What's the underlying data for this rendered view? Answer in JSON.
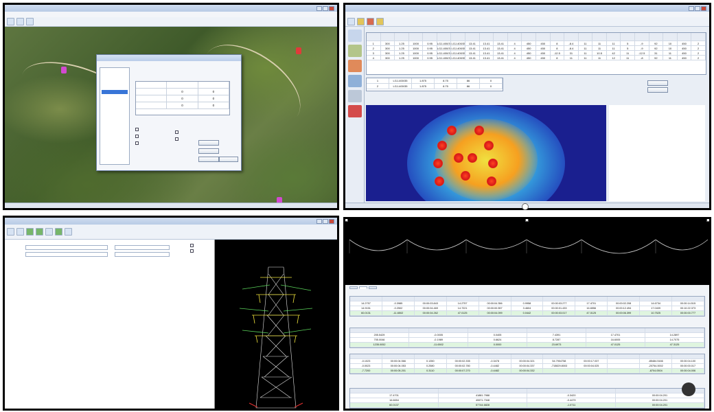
{
  "panel_tl": {
    "title": "",
    "coords": "",
    "status": "",
    "dialog": {
      "title": "",
      "tree_items": [
        "",
        "",
        "",
        "",
        "",
        "",
        ""
      ],
      "grid_cells": [
        "0",
        "0",
        "0",
        "0",
        "0",
        "0"
      ],
      "buttons": [
        "",
        "",
        "",
        ""
      ]
    }
  },
  "panel_tr": {
    "title": "",
    "table_rows": [
      [
        "1",
        "300",
        "1.25",
        "1000",
        "0.95",
        "LGJ-400/35",
        "LGJ-400/35",
        "13.41",
        "13.41",
        "13.41",
        "4",
        "450",
        "450",
        "8",
        "-8.4",
        "11",
        "11",
        "11",
        "5",
        "-9",
        "92",
        "10",
        "450",
        "2"
      ],
      [
        "2",
        "300",
        "1.25",
        "1000",
        "0.95",
        "LGJ-400/35",
        "LGJ-400/35",
        "13.41",
        "13.41",
        "13.41",
        "4",
        "450",
        "450",
        "8",
        "-8.4",
        "11",
        "11",
        "11",
        "5",
        "-9",
        "92",
        "10",
        "450",
        "2"
      ],
      [
        "3",
        "300",
        "1.25",
        "1000",
        "0.95",
        "LGJ-400/35",
        "LGJ-400/35",
        "13.41",
        "13.41",
        "13.41",
        "4",
        "450",
        "450",
        "-12.5",
        "31",
        "11",
        "10.5",
        "42",
        "11",
        "-12.5",
        "31",
        "11",
        "450",
        "2"
      ],
      [
        "4",
        "300",
        "1.25",
        "1000",
        "0.95",
        "LGJ-400/35",
        "LGJ-400/35",
        "13.41",
        "13.41",
        "13.41",
        "4",
        "450",
        "450",
        "8",
        "11",
        "11",
        "11",
        "12",
        "11",
        "-8",
        "92",
        "11",
        "450",
        "2"
      ]
    ],
    "sub_rows": [
      [
        "1",
        "LGJ-400/35",
        "1.875",
        "8.75",
        "86",
        "0"
      ],
      [
        "2",
        "LGJ-400/35",
        "1.875",
        "8.75",
        "86",
        "0"
      ]
    ],
    "buttons": [
      "",
      ""
    ],
    "legend_lines": []
  },
  "panel_bl": {
    "title": "",
    "text_lines": []
  },
  "panel_br": {
    "catenary_labels": [],
    "tables": [
      {
        "rows": [
          [
            "14.2757",
            "-0.3985",
            "00:00:03.843",
            "14.2757",
            "00:00:04.356",
            "0.9958",
            "00:00:03.277",
            "17.4701",
            "00:00:02.208",
            "14.6734",
            "00:00:14.515"
          ],
          [
            "14.9151",
            "-0.2502",
            "00:00:04.469",
            "14.7221",
            "00:00:00.557",
            "3.4604",
            "00:00:01.433",
            "16.6556",
            "00:00:12.494",
            "17.0409",
            "00:10:22.373"
          ],
          [
            "60.0131",
            "-11.6502",
            "00:00:04.262",
            "47.0125",
            "00:00:04.099",
            "0.0442",
            "00:00:03.017",
            "47.0125",
            "00:00:06.399",
            "10.7525",
            "00:00:00.777"
          ]
        ]
      },
      {
        "rows": [
          [
            "205.5429",
            "-0.0005",
            "0.0405",
            "7.4391",
            "17.4701",
            "14.2897"
          ],
          [
            "705.0046",
            "-0.1989",
            "0.6624",
            "8.7287",
            "16.6005",
            "14.7075"
          ],
          [
            "1235.0052",
            "-11.6502",
            "0.0000",
            "23.6973",
            "47.0125",
            "47.3125"
          ]
        ]
      },
      {
        "rows": [
          [
            "-0.1023",
            "00:00:04.566",
            "0.1350",
            "00:00:02.335",
            "-0.3478",
            "00:00:04.321",
            "54.7904758",
            "00:00:17.037",
            "",
            "-85484.5166",
            "00:00:04.100"
          ],
          [
            "-0.0023",
            "00:00:04.053",
            "0.2580",
            "00:00:02.780",
            "-0.4482",
            "00:00:04.337",
            "-715829.8003",
            "00:00:04.025",
            "",
            "-20754.0002",
            "00:00:00.017"
          ],
          [
            "-7.7200",
            "00:00:05.201",
            "0.3110",
            "00:00:07.270",
            "-0.4482",
            "00:00:04.332",
            "",
            "",
            "",
            "-8704.0504",
            "00:00:04.006"
          ]
        ]
      },
      {
        "rows": [
          [
            "17.4701",
            "41881.7988",
            "-0.3420",
            "00:00:04.201"
          ],
          [
            "16.6654",
            "40671.7348",
            "-0.4479",
            "00:00:04.201"
          ],
          [
            "60.0137",
            "57744.6828",
            "-1.0711",
            "00:00:04.201"
          ]
        ]
      }
    ]
  },
  "watermark": {
    "logo_glyph": "",
    "text": ""
  }
}
